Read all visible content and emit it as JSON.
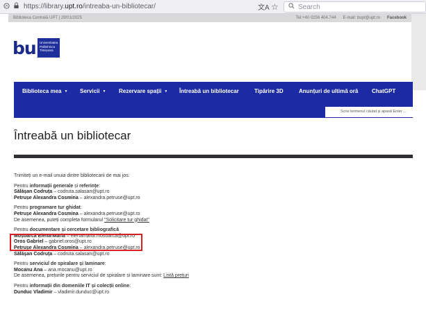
{
  "browser": {
    "url_prefix": "https://library.",
    "url_host": "upt.ro",
    "url_path": "/intreaba-un-bibliotecar/",
    "search_placeholder": "Search",
    "translate_icon": "文A",
    "star_icon": "☆"
  },
  "top_strip": {
    "left": "Biblioteca Centrală UPT | 29/01/2025",
    "phone": "Tel:+40 0256 404.744",
    "email": "E-mail: bupt@upt.ro",
    "facebook": "Facebook"
  },
  "logo": {
    "text": "bup",
    "line1": "Universitatea",
    "line2": "Politehnica",
    "line3": "Timișoara"
  },
  "nav": {
    "items": [
      {
        "label": "Biblioteca mea",
        "caret": "▼"
      },
      {
        "label": "Servicii",
        "caret": "▼"
      },
      {
        "label": "Rezervare spații",
        "caret": "▼"
      },
      {
        "label": "Întreabă un bibliotecar",
        "caret": ""
      },
      {
        "label": "Tipărire 3D",
        "caret": ""
      },
      {
        "label": "Anunțuri de ultimă oră",
        "caret": ""
      },
      {
        "label": "ChatGPT",
        "caret": ""
      }
    ],
    "search_placeholder": "Scrie termenul căutat și apasă Enter ..."
  },
  "page": {
    "title": "Întreabă un bibliotecar",
    "intro": "Trimiteți un e-mail unuia dintre bibliotecarii de mai jos:",
    "blocks": [
      {
        "pre": "Pentru ",
        "topic": "informații generale",
        "mid": " și ",
        "topic2": "referințe",
        "post": ":",
        "people": [
          {
            "name": "Sălășan Codruța",
            "email": " – codruta.salasan@upt.ro"
          },
          {
            "name": "Petrușe Alexandra Cosmina",
            "email": " – alexandra.petruse@upt.ro"
          }
        ]
      },
      {
        "pre": "Pentru ",
        "topic": "programare tur ghidat",
        "post": ":",
        "people": [
          {
            "name": "Petrușe Alexandra Cosmina",
            "email": " – alexandra.petruse@upt.ro"
          }
        ],
        "note": "De asemenea, puteți completa formularul ",
        "note_link": "\"Solicitare tur ghidat\""
      },
      {
        "pre": "Pentru ",
        "topic": "documentare și cercetare bibliografică",
        "post": "",
        "people": [
          {
            "name": "Moșoarcă Elena-Maria",
            "email": " – elenamaria.mosoarca@upt.ro"
          },
          {
            "name": "Oros Gabriel",
            "email": " – gabriel.oros@upt.ro"
          },
          {
            "name": "Petrușe Alexandra Cosmina",
            "email": " – alexandra.petruse@upt.ro"
          },
          {
            "name": "Sălășan Codruța",
            "email": " – codruta.salasan@upt.ro"
          }
        ]
      },
      {
        "pre": "Pentru ",
        "topic": "serviciul de spiralare și laminare",
        "post": ":",
        "people": [
          {
            "name": "Mocanu Ana",
            "email": " – ana.mocanu@upt.ro"
          }
        ],
        "note": "De asemenea, prețurile pentru serviciul de spiralare și laminare sunt: ",
        "note_link": "Listă prețuri"
      },
      {
        "pre": "Pentru ",
        "topic": "informații din domeniile IT și colecții online",
        "post": ":",
        "people": [
          {
            "name": "Dunduc Vladimir",
            "email": " – vladimir.dunduc@upt.ro"
          }
        ]
      }
    ]
  },
  "colors": {
    "nav_bg": "#1c2aa3",
    "highlight": "#d81f26",
    "rule": "#2e2e33"
  }
}
